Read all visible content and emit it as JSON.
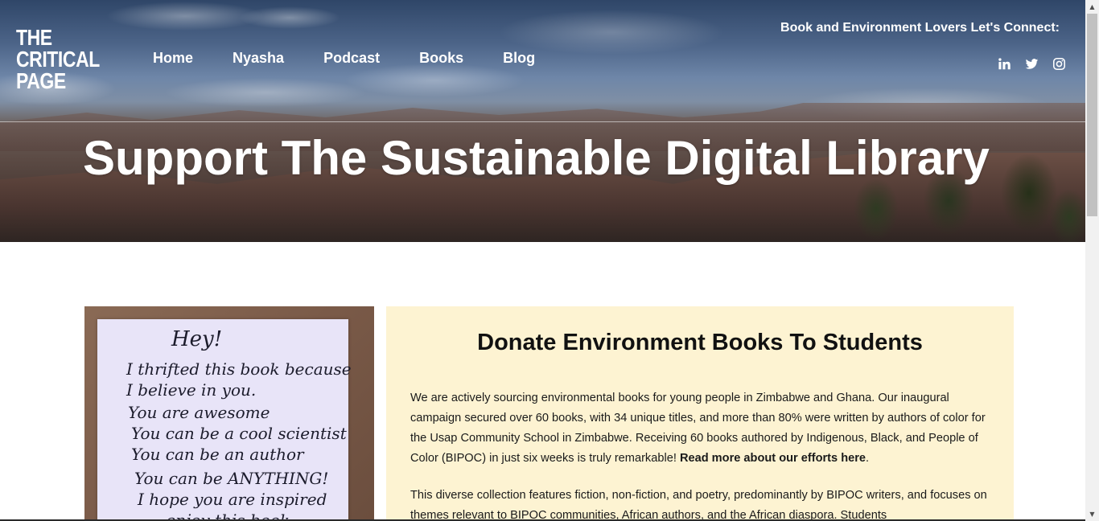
{
  "logo": {
    "line1": "THE",
    "line2": "CRITICAL",
    "line3": "PAGE"
  },
  "nav": {
    "items": [
      {
        "label": "Home"
      },
      {
        "label": "Nyasha"
      },
      {
        "label": "Podcast"
      },
      {
        "label": "Books"
      },
      {
        "label": "Blog"
      }
    ]
  },
  "connect": {
    "label": "Book and Environment Lovers Let's Connect:",
    "icons": [
      "linkedin-icon",
      "twitter-icon",
      "instagram-icon"
    ]
  },
  "hero": {
    "title": "Support The Sustainable Digital Library"
  },
  "photo": {
    "lines": [
      "Hey!",
      "I thrifted this book because",
      "I believe in you.",
      "You are awesome",
      "You can be a cool scientist",
      "You can be an author",
      "You can be ANYTHING!",
      "I hope you are inspired",
      "... enjoy this book....."
    ]
  },
  "donate": {
    "title": "Donate Environment Books To Students",
    "p1_text": "We are actively sourcing environmental books for young people in Zimbabwe and Ghana. Our inaugural campaign secured over 60 books, with 34 unique titles, and more than 80% were written by authors of color for the Usap Community School in Zimbabwe. Receiving 60 books authored by Indigenous, Black, and People of Color (BIPOC) in just six weeks is truly remarkable! ",
    "p1_link": "Read more about our efforts here",
    "p1_end": ".",
    "p2_text": "This diverse collection features fiction, non-fiction, and poetry, predominantly by BIPOC writers, and focuses on themes relevant to BIPOC communities, African authors, and the African diaspora. Students"
  },
  "colors": {
    "panel_bg": "#fdf3d2",
    "hero_text": "#ffffff"
  }
}
